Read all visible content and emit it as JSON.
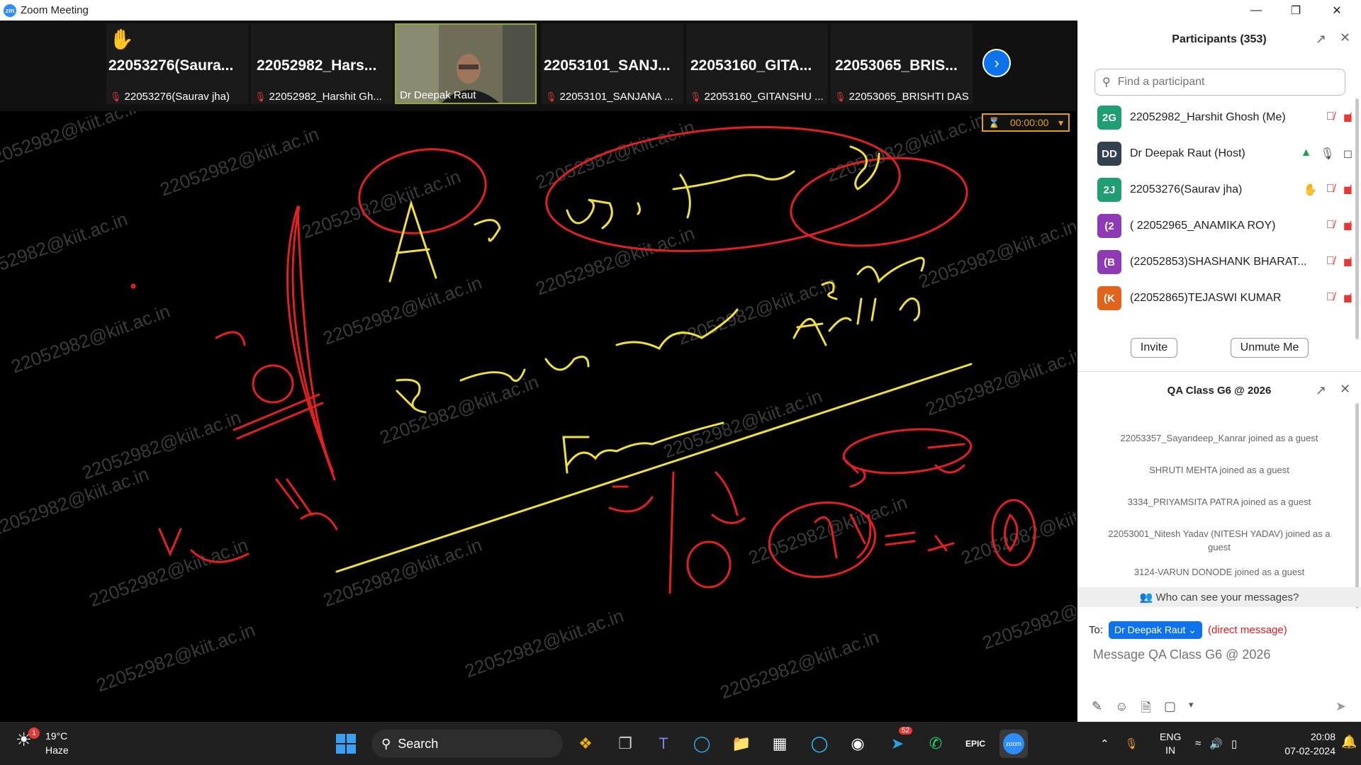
{
  "window": {
    "title": "Zoom Meeting",
    "app_icon": "zm"
  },
  "video_strip": {
    "tiles": [
      {
        "big": "22053276(Saura...",
        "small": "22053276(Saurav jha)",
        "hand": true
      },
      {
        "big": "22052982_Hars...",
        "small": "22052982_Harshit Gh..."
      },
      {
        "big": "",
        "small": "Dr Deepak Raut",
        "video": true
      },
      {
        "big": "22053101_SANJ...",
        "small": "22053101_SANJANA ..."
      },
      {
        "big": "22053160_GITA...",
        "small": "22053160_GITANSHU ..."
      },
      {
        "big": "22053065_BRIS...",
        "small": "22053065_BRISHTI DAS"
      }
    ]
  },
  "timer": {
    "value": "00:00:00"
  },
  "watermark": "22052982@kiit.ac.in",
  "participants": {
    "title": "Participants (353)",
    "search_placeholder": "Find a participant",
    "list": [
      {
        "initials": "2G",
        "name": "22052982_Harshit Ghosh (Me)",
        "color": "#1e9e72"
      },
      {
        "initials": "DD",
        "name": "Dr Deepak Raut (Host)",
        "color": "#33414e"
      },
      {
        "initials": "2J",
        "name": "22053276(Saurav jha)",
        "color": "#1e9e72"
      },
      {
        "initials": "(2",
        "name": "( 22052965_ANAMIKA ROY)",
        "color": "#8e3ab5"
      },
      {
        "initials": "(B",
        "name": "(22052853)SHASHANK BHARAT...",
        "color": "#8e3ab5"
      },
      {
        "initials": "(K",
        "name": "(22052865)TEJASWI KUMAR",
        "color": "#e0641b"
      }
    ],
    "invite_label": "Invite",
    "unmute_label": "Unmute Me"
  },
  "chat": {
    "title": "QA Class G6 @ 2026",
    "messages": [
      "22053357_Sayandeep_Kanrar joined as a guest",
      "SHRUTI MEHTA joined as a guest",
      "3334_PRIYAMSITA PATRA joined as a guest",
      "22053001_Nitesh Yadav (NITESH YADAV) joined as a guest",
      "3124-VARUN DONODE joined as a guest"
    ],
    "who_can_see": "Who can see your messages?",
    "to_label": "To:",
    "recipient": "Dr Deepak Raut",
    "direct_note": "(direct message)",
    "input_placeholder": "Message QA Class G6 @ 2026"
  },
  "taskbar": {
    "weather_temp": "19°C",
    "weather_desc": "Haze",
    "weather_badge": "1",
    "search_label": "Search",
    "telegram_badge": "52",
    "lang_top": "ENG",
    "lang_bottom": "IN",
    "time": "20:08",
    "date": "07-02-2024"
  }
}
